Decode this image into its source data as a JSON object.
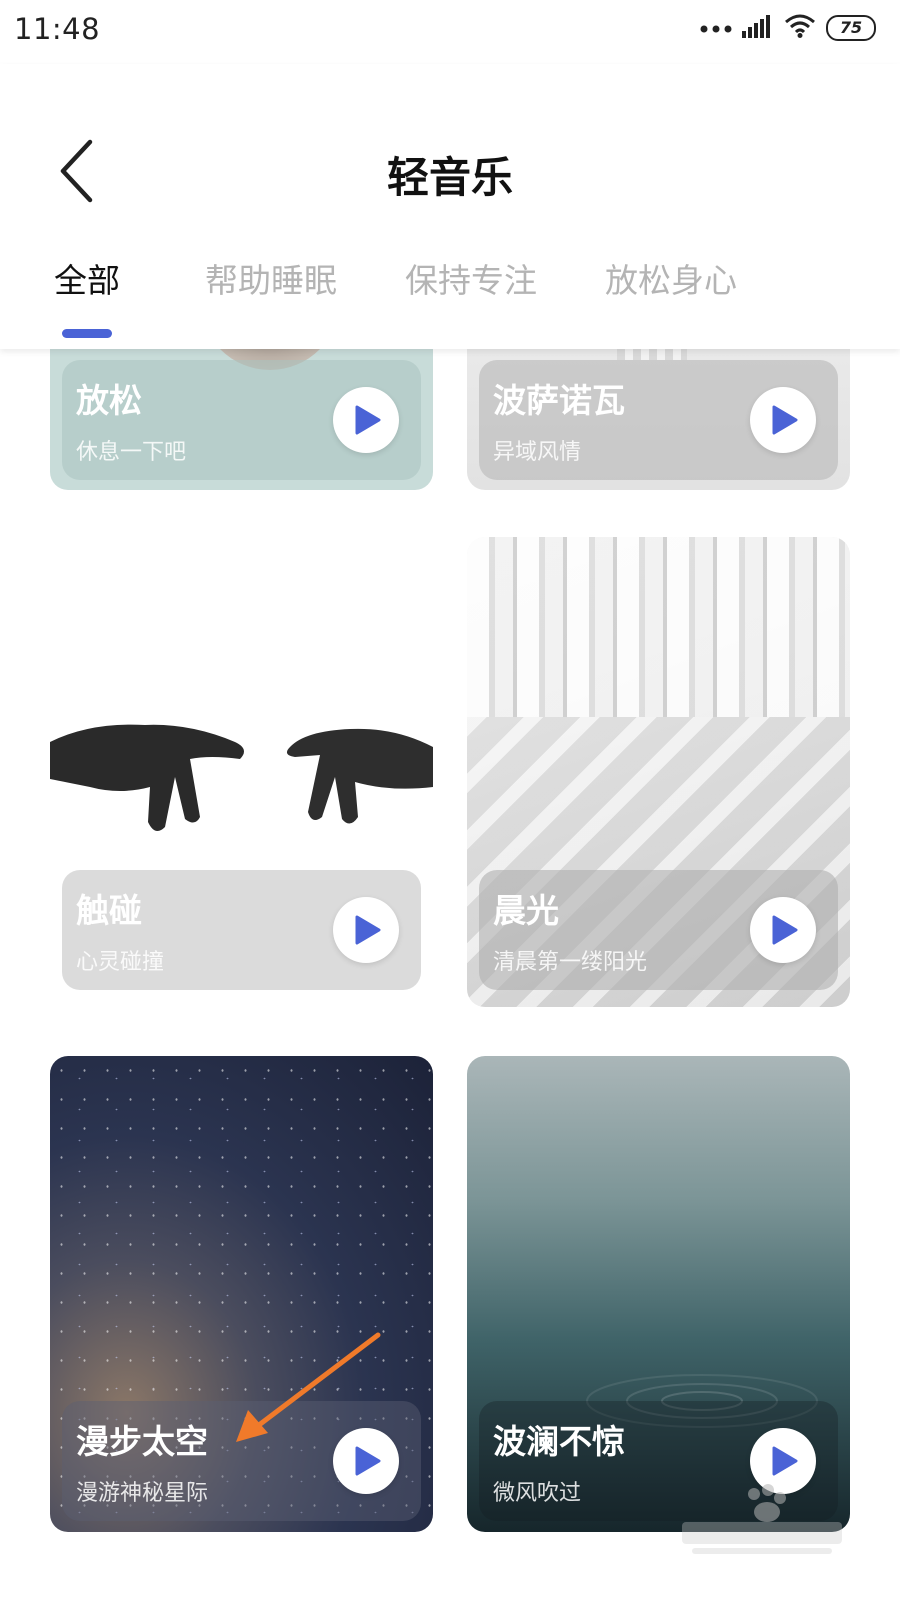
{
  "status": {
    "time": "11:48",
    "battery": "75"
  },
  "header": {
    "title": "轻音乐"
  },
  "tabs": [
    {
      "label": "全部",
      "active": true
    },
    {
      "label": "帮助睡眠",
      "active": false
    },
    {
      "label": "保持专注",
      "active": false
    },
    {
      "label": "放松身心",
      "active": false
    }
  ],
  "cards": [
    {
      "title": "放松",
      "subtitle": "休息一下吧"
    },
    {
      "title": "波萨诺瓦",
      "subtitle": "异域风情"
    },
    {
      "title": "触碰",
      "subtitle": "心灵碰撞"
    },
    {
      "title": "晨光",
      "subtitle": "清晨第一缕阳光"
    },
    {
      "title": "漫步太空",
      "subtitle": "漫游神秘星际"
    },
    {
      "title": "波澜不惊",
      "subtitle": "微风吹过"
    }
  ],
  "colors": {
    "accent": "#4a63d6",
    "tab_inactive": "#b4b4b4"
  }
}
